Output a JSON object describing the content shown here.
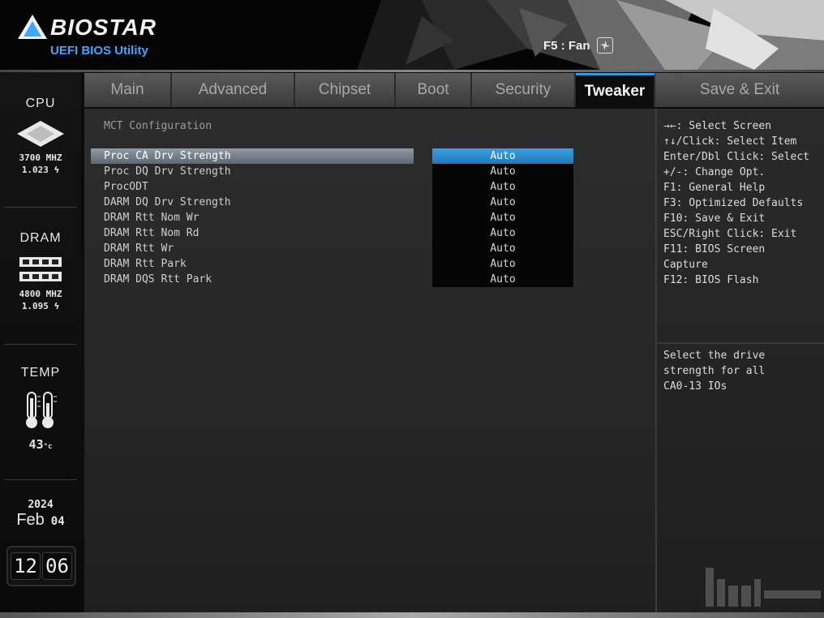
{
  "header": {
    "brand": "BIOSTAR",
    "subtitle": "UEFI BIOS Utility",
    "fan_hotkey": "F5 : Fan"
  },
  "status": {
    "cpu": {
      "title": "CPU",
      "freq": "3700 MHZ",
      "volt": "1.023 ϟ"
    },
    "dram": {
      "title": "DRAM",
      "freq": "4800 MHZ",
      "volt": "1.095 ϟ"
    },
    "temp": {
      "title": "TEMP",
      "value": "43",
      "unit": "°c"
    },
    "date": {
      "year": "2024",
      "month": "Feb",
      "day": "04"
    },
    "time": {
      "hour": "12",
      "minute": "06"
    }
  },
  "tabs": [
    {
      "label": "Main"
    },
    {
      "label": "Advanced"
    },
    {
      "label": "Chipset"
    },
    {
      "label": "Boot"
    },
    {
      "label": "Security"
    },
    {
      "label": "Tweaker"
    },
    {
      "label": "Save & Exit"
    }
  ],
  "active_tab": "Tweaker",
  "main": {
    "section_title": "MCT Configuration",
    "rows": [
      {
        "label": "Proc CA Drv Strength",
        "value": "Auto"
      },
      {
        "label": "Proc DQ Drv Strength",
        "value": "Auto"
      },
      {
        "label": "ProcODT",
        "value": "Auto"
      },
      {
        "label": "DARM DQ Drv Strength",
        "value": "Auto"
      },
      {
        "label": "DRAM Rtt Nom Wr",
        "value": "Auto"
      },
      {
        "label": "DRAM Rtt Nom Rd",
        "value": "Auto"
      },
      {
        "label": "DRAM Rtt Wr",
        "value": "Auto"
      },
      {
        "label": "DRAM Rtt Park",
        "value": "Auto"
      },
      {
        "label": "DRAM DQS Rtt Park",
        "value": "Auto"
      }
    ]
  },
  "help": {
    "keys": [
      "→←: Select Screen",
      "↑↓/Click: Select Item",
      "Enter/Dbl Click: Select",
      "+/-: Change Opt.",
      "F1: General Help",
      "F3: Optimized Defaults",
      "F10: Save & Exit",
      "ESC/Right Click: Exit",
      "F11: BIOS Screen",
      "Capture",
      "F12: BIOS Flash"
    ],
    "description": [
      "Select the drive",
      "strength for all",
      "CA0-13 IOs"
    ]
  },
  "colors": {
    "accent": "#2f9ae8",
    "logo_blue": "#3ea7ff",
    "selected_value": "#1f78bd",
    "highlight_row": "#8e9aa6"
  }
}
